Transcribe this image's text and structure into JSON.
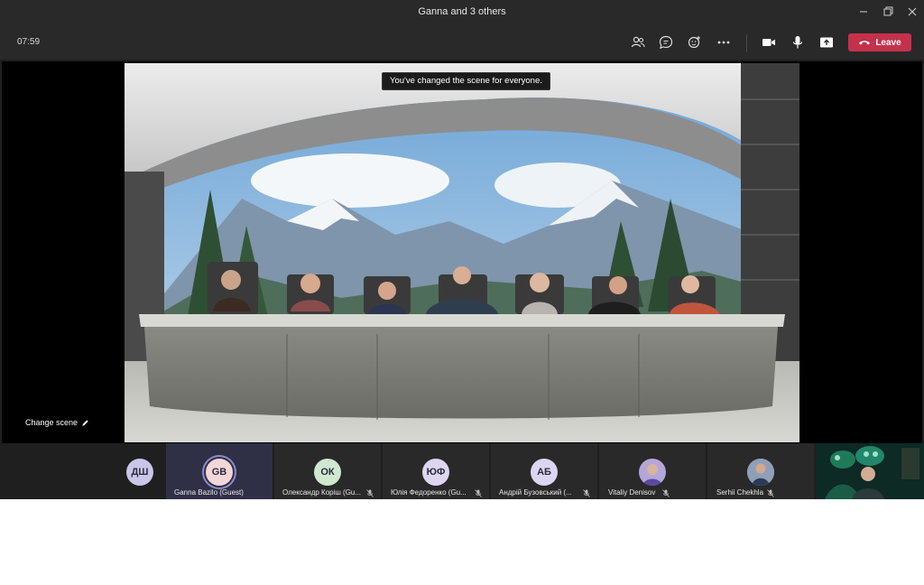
{
  "window": {
    "title": "Ganna and 3 others"
  },
  "toolbar": {
    "timer": "07:59",
    "leave_label": "Leave"
  },
  "scene": {
    "toast": "You've changed the scene for everyone.",
    "change_scene_label": "Change scene"
  },
  "participants": [
    {
      "initials": "ДШ",
      "name": "",
      "avatar_color": "#c9c6e8"
    },
    {
      "initials": "GB",
      "name": "Ganna Bazilo (Guest)",
      "avatar_color": "#f3d6d8"
    },
    {
      "initials": "ОК",
      "name": "Олександр Коріш (Gu...",
      "avatar_color": "#cfe8cf"
    },
    {
      "initials": "ЮФ",
      "name": "Юлія Федоренко (Gu...",
      "avatar_color": "#dcd6f0"
    },
    {
      "initials": "АБ",
      "name": "Андрій Бузовський (...",
      "avatar_color": "#dcd6f0"
    },
    {
      "initials": "",
      "name": "Vitaliy Denisov",
      "avatar_color": "#b4a6d8"
    },
    {
      "initials": "",
      "name": "Serhii Chekhla",
      "avatar_color": "#a8b4d0"
    }
  ],
  "colors": {
    "leave": "#c4314b",
    "background": "#1f1f1f",
    "active_ring": "#8b8cc7"
  },
  "icons": [
    "people-icon",
    "chat-icon",
    "reactions-icon",
    "more-icon",
    "camera-icon",
    "microphone-icon",
    "share-icon",
    "phone-hangup-icon"
  ]
}
